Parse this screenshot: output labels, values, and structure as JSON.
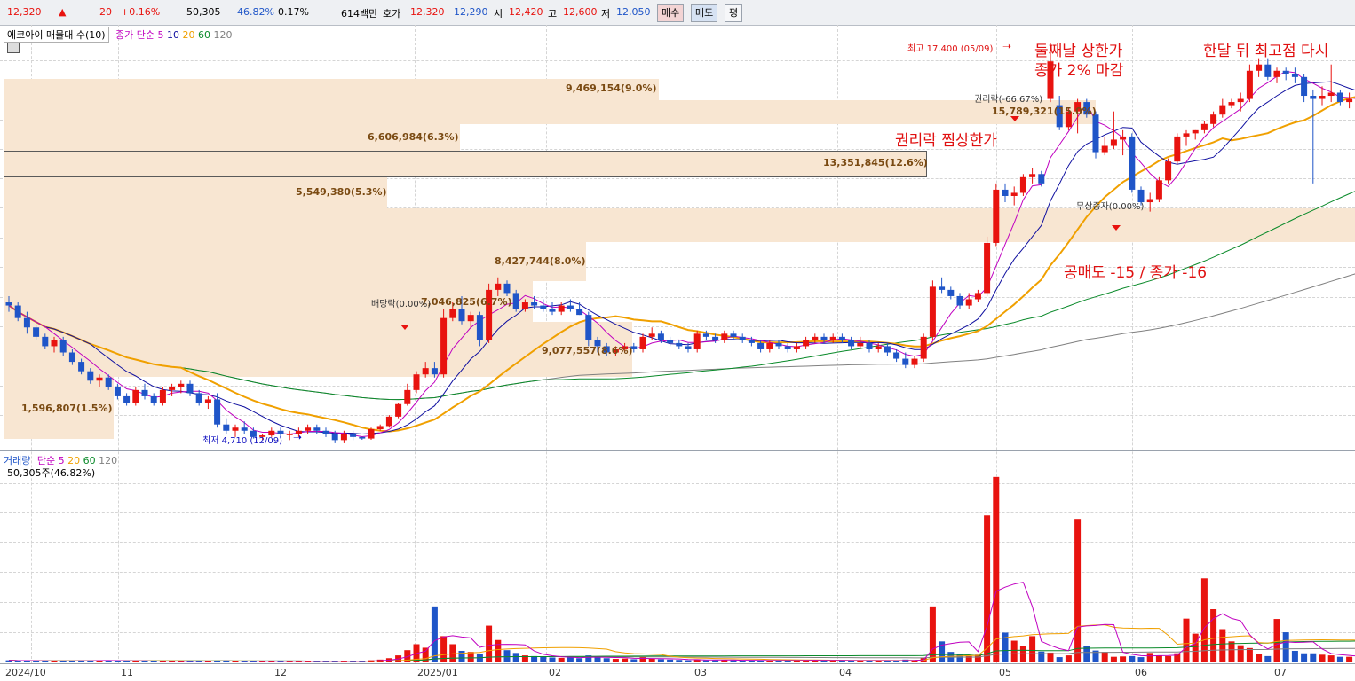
{
  "quote": {
    "price": "12,320",
    "direction": "▲",
    "change": "20",
    "change_pct": "+0.16%",
    "volume": "50,305",
    "volume_ratio": "46.82%",
    "turnover": "0.17%",
    "amount": "614백만",
    "bid_label": "호가",
    "ask": "12,320",
    "bid": "12,290",
    "open_label": "시",
    "open": "12,420",
    "high_label": "고",
    "high": "12,600",
    "low_label": "저",
    "low": "12,050",
    "buy_button": "매수",
    "sell_button": "매도",
    "avg_button": "평"
  },
  "price_legend": {
    "title": "에코아이 매물대 수(10)",
    "ma_title": "종가 단순",
    "ma": [
      {
        "label": "5",
        "color": "#c000c0"
      },
      {
        "label": "10",
        "color": "#1010a0"
      },
      {
        "label": "20",
        "color": "#f0a000"
      },
      {
        "label": "60",
        "color": "#0a8a2a"
      },
      {
        "label": "120",
        "color": "#808080"
      }
    ]
  },
  "volume_legend": {
    "title": "거래량",
    "ma_title": "단순",
    "ma": [
      {
        "label": "5",
        "color": "#c000c0"
      },
      {
        "label": "20",
        "color": "#f0a000"
      },
      {
        "label": "60",
        "color": "#0a8a2a"
      },
      {
        "label": "120",
        "color": "#808080"
      }
    ],
    "current": "50,305주(46.82%)"
  },
  "volume_profile": [
    {
      "label": "9,469,154(9.0%)"
    },
    {
      "label": "15,789,321(15.0%)"
    },
    {
      "label": "6,606,984(6.3%)"
    },
    {
      "label": "13,351,845(12.6%)"
    },
    {
      "label": "5,549,380(5.3%)"
    },
    {
      "label": ""
    },
    {
      "label": "8,427,744(8.0%)"
    },
    {
      "label": "7,046,825(6.7%)"
    },
    {
      "label": "9,077,557(8.6%)"
    },
    {
      "label": "1,596,807(1.5%)"
    }
  ],
  "markers": {
    "high": "최고 17,400 (05/09)",
    "low": "최저 4,710 (12/09)",
    "dividend": "배당락(0.00%)",
    "rights": "권리락(-66.67%)",
    "bonus": "무상증자(0.00%)"
  },
  "annotations": {
    "second_limit": "둘째날 상한가\n종가 2% 마감",
    "rights_limit": "권리락 찜상한가",
    "month_high": "한달 뒤 최고점 다시",
    "short_sell": "공매도 -15 / 종가 -16"
  },
  "x_axis": [
    "2024/10",
    "11",
    "12",
    "2025/01",
    "02",
    "03",
    "04",
    "05",
    "06",
    "07"
  ],
  "colors": {
    "up": "#e8130f",
    "down": "#1f55c8",
    "band": "#f8e6d2",
    "annotation": "#e01010"
  },
  "chart_data": {
    "type": "candlestick",
    "title": "에코아이",
    "candles": [
      [
        9100,
        9300,
        8800,
        9000
      ],
      [
        9000,
        9100,
        8500,
        8600
      ],
      [
        8600,
        8800,
        8100,
        8300
      ],
      [
        8300,
        8400,
        7900,
        8000
      ],
      [
        8000,
        8100,
        7600,
        7700
      ],
      [
        7700,
        8000,
        7500,
        7900
      ],
      [
        7900,
        8000,
        7400,
        7500
      ],
      [
        7500,
        7600,
        7100,
        7200
      ],
      [
        7200,
        7300,
        6800,
        6900
      ],
      [
        6900,
        7000,
        6500,
        6600
      ],
      [
        6600,
        6800,
        6400,
        6700
      ],
      [
        6700,
        6800,
        6300,
        6400
      ],
      [
        6400,
        6500,
        6000,
        6100
      ],
      [
        6100,
        6200,
        5800,
        5900
      ],
      [
        5900,
        6400,
        5800,
        6300
      ],
      [
        6300,
        6500,
        6000,
        6100
      ],
      [
        6100,
        6200,
        5800,
        5900
      ],
      [
        5900,
        6400,
        5800,
        6300
      ],
      [
        6300,
        6500,
        6100,
        6400
      ],
      [
        6400,
        6600,
        6200,
        6500
      ],
      [
        6500,
        6600,
        6100,
        6200
      ],
      [
        6200,
        6300,
        5800,
        5900
      ],
      [
        5900,
        6100,
        5700,
        6000
      ],
      [
        6000,
        6200,
        5100,
        5200
      ],
      [
        5200,
        5400,
        4900,
        5000
      ],
      [
        5000,
        5200,
        4800,
        5100
      ],
      [
        5100,
        5300,
        4900,
        5000
      ],
      [
        5000,
        5100,
        4750,
        4800
      ],
      [
        4800,
        4900,
        4710,
        4850
      ],
      [
        4850,
        5100,
        4800,
        5000
      ],
      [
        5000,
        5100,
        4800,
        4900
      ],
      [
        4900,
        5000,
        4700,
        4900
      ],
      [
        4900,
        5100,
        4800,
        5000
      ],
      [
        5000,
        5200,
        4900,
        5100
      ],
      [
        5100,
        5200,
        4900,
        5000
      ],
      [
        5000,
        5100,
        4800,
        4900
      ],
      [
        4900,
        5000,
        4600,
        4700
      ],
      [
        4700,
        5000,
        4600,
        4900
      ],
      [
        4900,
        5000,
        4700,
        4800
      ],
      [
        4800,
        4800,
        4710,
        4750
      ],
      [
        4750,
        5100,
        4710,
        5050
      ],
      [
        5050,
        5200,
        5000,
        5150
      ],
      [
        5150,
        5500,
        5100,
        5450
      ],
      [
        5450,
        5900,
        5400,
        5850
      ],
      [
        5850,
        6500,
        5800,
        6300
      ],
      [
        6300,
        6900,
        6200,
        6800
      ],
      [
        6800,
        7200,
        6700,
        7000
      ],
      [
        7000,
        7200,
        6700,
        6800
      ],
      [
        6800,
        8900,
        6700,
        8600
      ],
      [
        8600,
        9100,
        8500,
        8900
      ],
      [
        8900,
        9300,
        8400,
        8500
      ],
      [
        8500,
        8800,
        8300,
        8700
      ],
      [
        8700,
        8800,
        7700,
        7900
      ],
      [
        7900,
        9700,
        7800,
        9500
      ],
      [
        9500,
        9900,
        9300,
        9700
      ],
      [
        9700,
        9800,
        9300,
        9400
      ],
      [
        9400,
        9500,
        8800,
        8900
      ],
      [
        8900,
        9200,
        8800,
        9100
      ],
      [
        9100,
        9300,
        8900,
        9000
      ],
      [
        9000,
        9200,
        8800,
        8900
      ],
      [
        8900,
        9100,
        8700,
        8800
      ],
      [
        8800,
        9100,
        8700,
        9000
      ],
      [
        9000,
        9200,
        8800,
        8900
      ],
      [
        8900,
        9100,
        8700,
        8700
      ],
      [
        8700,
        8800,
        7700,
        7900
      ],
      [
        7900,
        8000,
        7500,
        7700
      ],
      [
        7700,
        7800,
        7400,
        7500
      ],
      [
        7500,
        7700,
        7400,
        7600
      ],
      [
        7600,
        7800,
        7500,
        7700
      ],
      [
        7700,
        7800,
        7500,
        7600
      ],
      [
        7600,
        8100,
        7500,
        8000
      ],
      [
        8000,
        8300,
        7900,
        8100
      ],
      [
        8100,
        8200,
        7800,
        7900
      ],
      [
        7900,
        8000,
        7700,
        7800
      ],
      [
        7800,
        7900,
        7600,
        7700
      ],
      [
        7700,
        7800,
        7500,
        7600
      ],
      [
        7600,
        8200,
        7500,
        8100
      ],
      [
        8100,
        8200,
        7900,
        8000
      ],
      [
        8000,
        8100,
        7800,
        7900
      ],
      [
        7900,
        8200,
        7800,
        8100
      ],
      [
        8100,
        8200,
        7900,
        8000
      ],
      [
        8000,
        8100,
        7800,
        7900
      ],
      [
        7900,
        8000,
        7700,
        7800
      ],
      [
        7800,
        7900,
        7500,
        7600
      ],
      [
        7600,
        7900,
        7500,
        7800
      ],
      [
        7800,
        7900,
        7600,
        7700
      ],
      [
        7700,
        7800,
        7500,
        7600
      ],
      [
        7600,
        7800,
        7500,
        7700
      ],
      [
        7700,
        8000,
        7600,
        7900
      ],
      [
        7900,
        8100,
        7800,
        8000
      ],
      [
        8000,
        8100,
        7800,
        7900
      ],
      [
        7900,
        8100,
        7800,
        8000
      ],
      [
        8000,
        8100,
        7800,
        7900
      ],
      [
        7900,
        8000,
        7600,
        7700
      ],
      [
        7700,
        8000,
        7600,
        7800
      ],
      [
        7800,
        7900,
        7500,
        7600
      ],
      [
        7600,
        7800,
        7500,
        7700
      ],
      [
        7700,
        7800,
        7400,
        7500
      ],
      [
        7500,
        7600,
        7200,
        7300
      ],
      [
        7300,
        7500,
        7000,
        7100
      ],
      [
        7100,
        7400,
        7000,
        7300
      ],
      [
        7300,
        8100,
        7200,
        8000
      ],
      [
        8000,
        9800,
        7900,
        9600
      ],
      [
        9600,
        9900,
        9400,
        9500
      ],
      [
        9500,
        9600,
        9200,
        9300
      ],
      [
        9300,
        9400,
        8900,
        9000
      ],
      [
        9000,
        9400,
        8900,
        9200
      ],
      [
        9200,
        9500,
        9100,
        9400
      ],
      [
        9400,
        11200,
        9300,
        11000
      ],
      [
        11000,
        12900,
        10900,
        12700
      ],
      [
        12700,
        12900,
        12300,
        12500
      ],
      [
        12500,
        12800,
        12200,
        12600
      ],
      [
        12600,
        13200,
        12500,
        13100
      ],
      [
        13100,
        13400,
        12900,
        13200
      ],
      [
        13200,
        13300,
        12800,
        12900
      ],
      [
        15600,
        17400,
        15500,
        16800
      ],
      [
        15400,
        15700,
        14600,
        14700
      ],
      [
        14700,
        15300,
        14600,
        15200
      ],
      [
        15200,
        15600,
        14500,
        15500
      ],
      [
        15500,
        15600,
        15000,
        15100
      ],
      [
        15100,
        15200,
        13700,
        13900
      ],
      [
        13900,
        14400,
        13800,
        14100
      ],
      [
        14100,
        15200,
        14000,
        14300
      ],
      [
        14300,
        14600,
        13800,
        14400
      ],
      [
        14400,
        14500,
        12600,
        12700
      ],
      [
        12700,
        12800,
        12200,
        12300
      ],
      [
        12300,
        12600,
        12000,
        12400
      ],
      [
        12400,
        13100,
        12300,
        13000
      ],
      [
        13000,
        13700,
        12900,
        13600
      ],
      [
        13600,
        14500,
        13500,
        14400
      ],
      [
        14400,
        14600,
        14100,
        14500
      ],
      [
        14500,
        14600,
        14300,
        14600
      ],
      [
        14600,
        14900,
        14500,
        14800
      ],
      [
        14800,
        15200,
        14700,
        15100
      ],
      [
        15100,
        15600,
        15000,
        15400
      ],
      [
        15400,
        15600,
        15300,
        15500
      ],
      [
        15500,
        15800,
        15200,
        15600
      ],
      [
        15600,
        16700,
        15500,
        16500
      ],
      [
        16500,
        16900,
        16300,
        16700
      ],
      [
        16700,
        16900,
        16200,
        16300
      ],
      [
        16300,
        16600,
        16100,
        16500
      ],
      [
        16500,
        16600,
        16200,
        16400
      ],
      [
        16400,
        16600,
        16100,
        16300
      ],
      [
        16300,
        16400,
        15500,
        15700
      ],
      [
        15700,
        15900,
        12900,
        15600
      ],
      [
        15600,
        16000,
        15400,
        15700
      ],
      [
        15700,
        16700,
        15500,
        15800
      ],
      [
        15800,
        15900,
        15400,
        15500
      ],
      [
        15500,
        15800,
        15300,
        15600
      ],
      [
        15600,
        15700,
        15400,
        15400
      ]
    ],
    "volume_max": 5600000,
    "volume": [
      60000,
      40000,
      50000,
      40000,
      30000,
      40000,
      40000,
      50000,
      60000,
      40000,
      60000,
      50000,
      40000,
      30000,
      50000,
      40000,
      30000,
      30000,
      40000,
      30000,
      40000,
      40000,
      30000,
      50000,
      40000,
      30000,
      30000,
      30000,
      40000,
      30000,
      30000,
      30000,
      30000,
      30000,
      30000,
      30000,
      30000,
      40000,
      30000,
      30000,
      60000,
      80000,
      120000,
      200000,
      350000,
      520000,
      420000,
      1600000,
      750000,
      520000,
      330000,
      300000,
      250000,
      1050000,
      640000,
      350000,
      270000,
      200000,
      180000,
      160000,
      140000,
      130000,
      140000,
      120000,
      200000,
      160000,
      120000,
      100000,
      110000,
      90000,
      150000,
      110000,
      90000,
      80000,
      70000,
      60000,
      90000,
      60000,
      60000,
      70000,
      60000,
      50000,
      60000,
      50000,
      50000,
      60000,
      50000,
      60000,
      70000,
      60000,
      50000,
      50000,
      50000,
      50000,
      50000,
      50000,
      50000,
      50000,
      40000,
      80000,
      60000,
      130000,
      1600000,
      600000,
      300000,
      250000,
      180000,
      220000,
      4200000,
      5300000,
      850000,
      620000,
      470000,
      750000,
      310000,
      280000,
      150000,
      200000,
      4100000,
      480000,
      340000,
      300000,
      160000,
      170000,
      180000,
      150000,
      270000,
      190000,
      180000,
      260000,
      1250000,
      820000,
      2400000,
      1520000,
      950000,
      600000,
      490000,
      410000,
      240000,
      180000,
      1240000,
      860000,
      330000,
      260000,
      260000,
      220000,
      200000,
      160000,
      160000,
      150000
    ]
  }
}
